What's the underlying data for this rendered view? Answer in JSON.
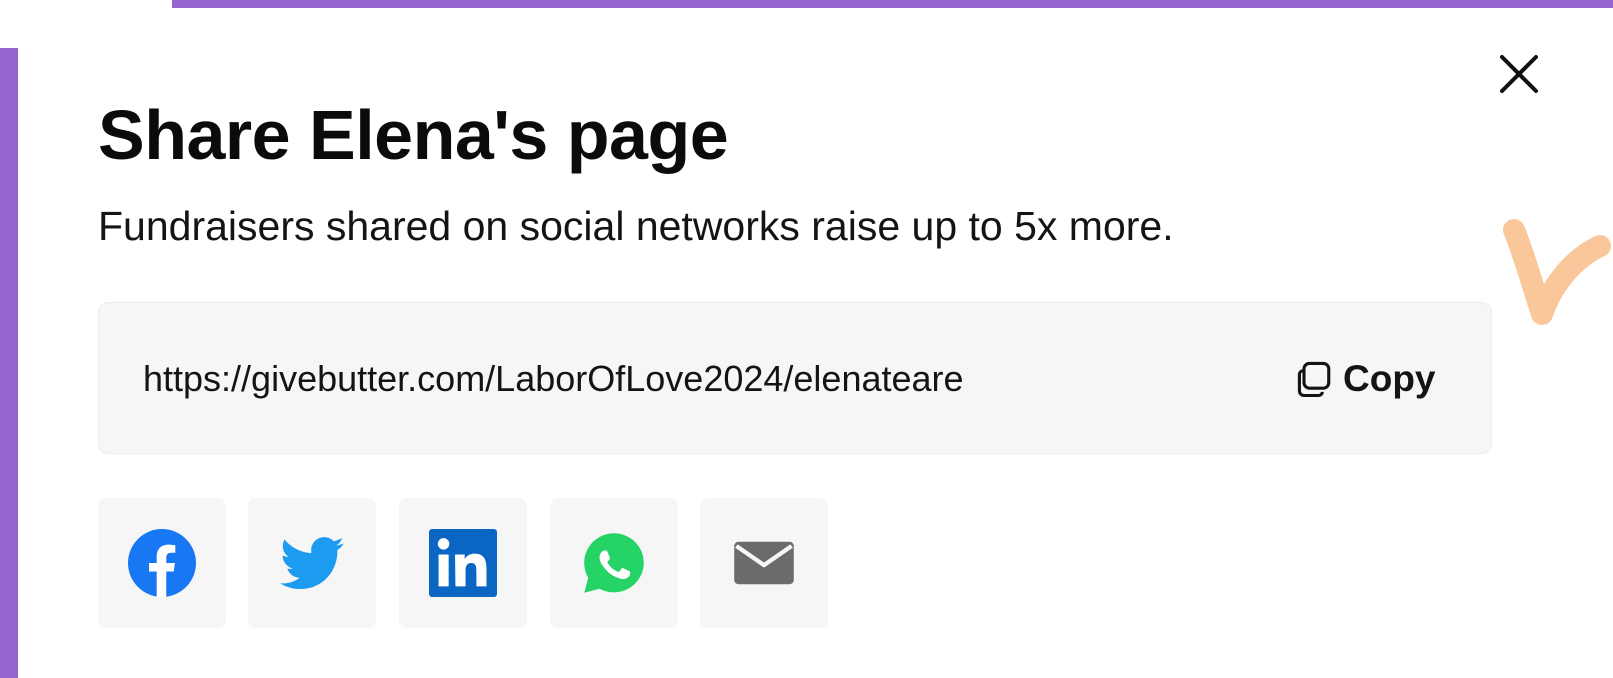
{
  "modal": {
    "title": "Share Elena's page",
    "subtitle": "Fundraisers shared on social networks raise up to 5x more.",
    "share_url": "https://givebutter.com/LaborOfLove2024/elenateare",
    "copy_label": "Copy"
  },
  "share_buttons": [
    {
      "icon": "facebook-icon",
      "color": "#1877f2"
    },
    {
      "icon": "twitter-icon",
      "color": "#1d9bf0"
    },
    {
      "icon": "linkedin-icon",
      "color": "#0a66c2"
    },
    {
      "icon": "whatsapp-icon",
      "color": "#25d366"
    },
    {
      "icon": "email-icon",
      "color": "#6b6b6b"
    }
  ],
  "colors": {
    "accent": "#9664cf",
    "box_bg": "#f6f6f6",
    "decoration": "#f9c79a"
  }
}
